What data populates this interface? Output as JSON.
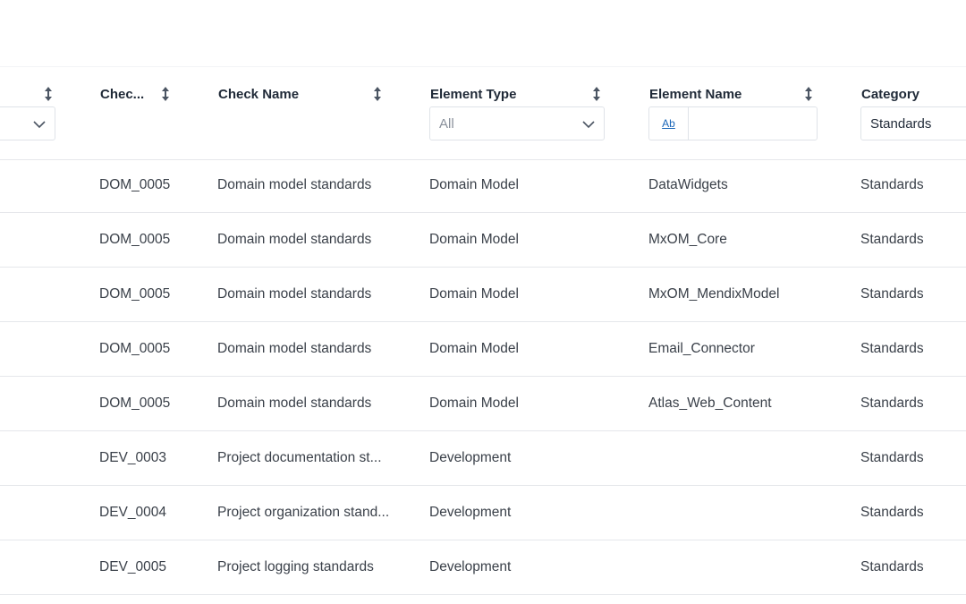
{
  "header": {
    "col0": {
      "filter_value": ""
    },
    "check": {
      "title": "Chec..."
    },
    "check_name": {
      "title": "Check Name"
    },
    "element_type": {
      "title": "Element Type",
      "filter_value": "All"
    },
    "element_name": {
      "title": "Element Name",
      "ab_label": "Ab",
      "filter_value": ""
    },
    "category": {
      "title": "Category",
      "filter_value": "Standards"
    }
  },
  "rows": [
    {
      "code": "DOM_0005",
      "name": "Domain model standards",
      "type": "Domain Model",
      "element": "DataWidgets",
      "category": "Standards"
    },
    {
      "code": "DOM_0005",
      "name": "Domain model standards",
      "type": "Domain Model",
      "element": "MxOM_Core",
      "category": "Standards"
    },
    {
      "code": "DOM_0005",
      "name": "Domain model standards",
      "type": "Domain Model",
      "element": "MxOM_MendixModel",
      "category": "Standards"
    },
    {
      "code": "DOM_0005",
      "name": "Domain model standards",
      "type": "Domain Model",
      "element": "Email_Connector",
      "category": "Standards"
    },
    {
      "code": "DOM_0005",
      "name": "Domain model standards",
      "type": "Domain Model",
      "element": "Atlas_Web_Content",
      "category": "Standards"
    },
    {
      "code": "DEV_0003",
      "name": "Project documentation st...",
      "type": "Development",
      "element": "",
      "category": "Standards"
    },
    {
      "code": "DEV_0004",
      "name": "Project organization stand...",
      "type": "Development",
      "element": "",
      "category": "Standards"
    },
    {
      "code": "DEV_0005",
      "name": "Project logging standards",
      "type": "Development",
      "element": "",
      "category": "Standards"
    }
  ]
}
